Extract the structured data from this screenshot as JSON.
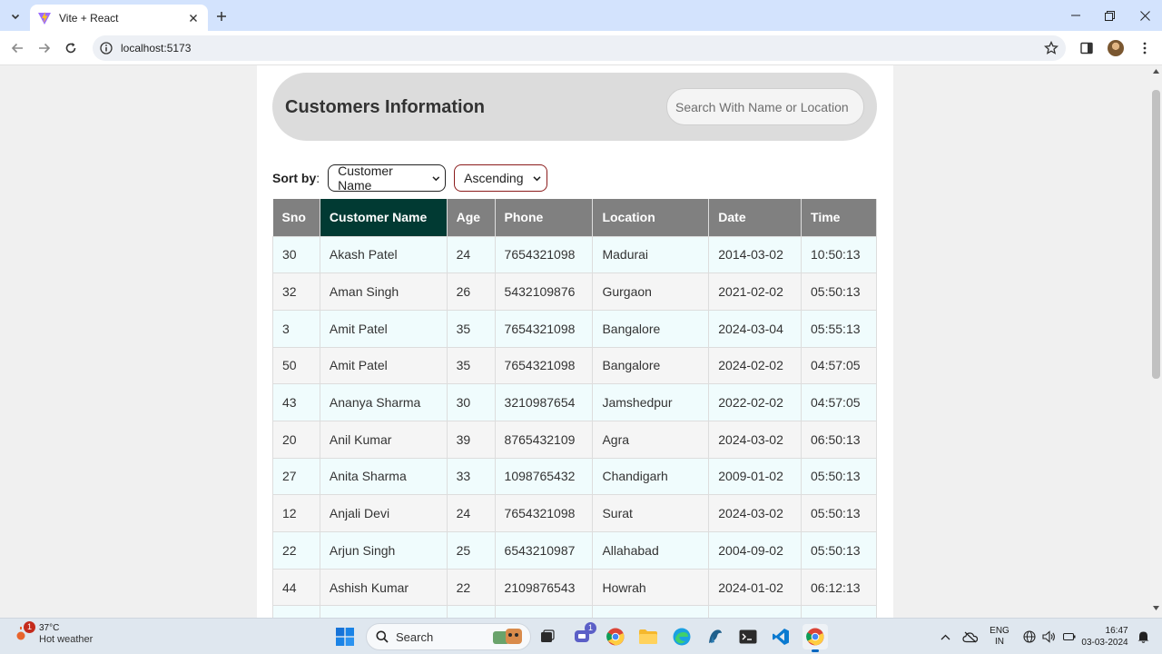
{
  "browser": {
    "tab_title": "Vite + React",
    "url": "localhost:5173"
  },
  "page": {
    "title": "Customers Information",
    "search": {
      "placeholder": "Search With Name or Location",
      "value": ""
    },
    "sort": {
      "label": "Sort by",
      "colon": ":",
      "field_selected": "Customer Name",
      "order_selected": "Ascending"
    },
    "table": {
      "columns": [
        "Sno",
        "Customer Name",
        "Age",
        "Phone",
        "Location",
        "Date",
        "Time"
      ],
      "active_column": "Customer Name",
      "rows": [
        [
          "30",
          "Akash Patel",
          "24",
          "7654321098",
          "Madurai",
          "2014-03-02",
          "10:50:13"
        ],
        [
          "32",
          "Aman Singh",
          "26",
          "5432109876",
          "Gurgaon",
          "2021-02-02",
          "05:50:13"
        ],
        [
          "3",
          "Amit Patel",
          "35",
          "7654321098",
          "Bangalore",
          "2024-03-04",
          "05:55:13"
        ],
        [
          "50",
          "Amit Patel",
          "35",
          "7654321098",
          "Bangalore",
          "2024-02-02",
          "04:57:05"
        ],
        [
          "43",
          "Ananya Sharma",
          "30",
          "3210987654",
          "Jamshedpur",
          "2022-02-02",
          "04:57:05"
        ],
        [
          "20",
          "Anil Kumar",
          "39",
          "8765432109",
          "Agra",
          "2024-03-02",
          "06:50:13"
        ],
        [
          "27",
          "Anita Sharma",
          "33",
          "1098765432",
          "Chandigarh",
          "2009-01-02",
          "05:50:13"
        ],
        [
          "12",
          "Anjali Devi",
          "24",
          "7654321098",
          "Surat",
          "2024-03-02",
          "05:50:13"
        ],
        [
          "22",
          "Arjun Singh",
          "25",
          "6543210987",
          "Allahabad",
          "2004-09-02",
          "05:50:13"
        ],
        [
          "44",
          "Ashish Kumar",
          "22",
          "2109876543",
          "Howrah",
          "2024-01-02",
          "06:12:13"
        ],
        [
          "",
          "",
          "",
          "",
          "",
          "",
          ""
        ]
      ]
    }
  },
  "taskbar": {
    "weather": {
      "temp": "37°C",
      "desc": "Hot weather",
      "badge": "1"
    },
    "search_label": "Search",
    "teams_badge": "1",
    "language": {
      "line1": "ENG",
      "line2": "IN"
    },
    "clock": {
      "time": "16:47",
      "date": "03-03-2024"
    }
  },
  "colors": {
    "active_header": "#013a33",
    "header_bg": "#808080",
    "row_odd": "#f0fcfd",
    "row_even": "#f5f5f5",
    "order_select_border": "#8b1c1c"
  }
}
